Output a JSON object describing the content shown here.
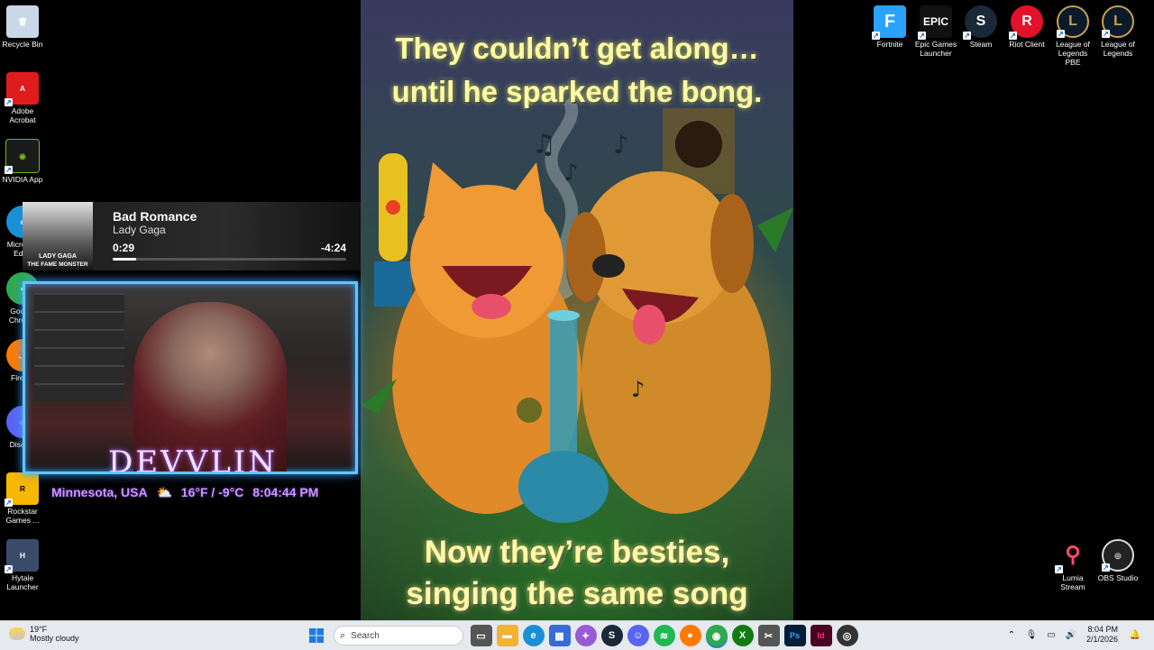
{
  "desktop": {
    "left_icons": [
      {
        "label": "Recycle Bin",
        "icon": "recycle-bin-icon",
        "color": "#c9d7e8"
      },
      {
        "label": "Adobe Acrobat",
        "icon": "acrobat-icon",
        "color": "#e01b1b"
      },
      {
        "label": "NVIDIA App",
        "icon": "nvidia-icon",
        "color": "#1a1a1a"
      },
      {
        "label": "Microsoft Edge",
        "icon": "edge-icon",
        "color": "#1b8fd6"
      },
      {
        "label": "Google Chrome",
        "icon": "chrome-icon",
        "color": "#2fa84f"
      },
      {
        "label": "Firefox",
        "icon": "firefox-icon",
        "color": "#ff7a00"
      },
      {
        "label": "Discord",
        "icon": "discord-icon",
        "color": "#5865f2"
      },
      {
        "label": "Rockstar Games ...",
        "icon": "rockstar-icon",
        "color": "#f6b800"
      },
      {
        "label": "Hytale Launcher",
        "icon": "hytale-icon",
        "color": "#3a4a6a"
      }
    ],
    "top_right_icons": [
      {
        "label": "Fortnite",
        "icon": "fortnite-icon",
        "color": "#2aa2ff",
        "glyph": "F"
      },
      {
        "label": "Epic Games Launcher",
        "icon": "epic-games-icon",
        "color": "#111111",
        "glyph": "EPIC"
      },
      {
        "label": "Steam",
        "icon": "steam-icon",
        "color": "#1b2838",
        "glyph": "S"
      },
      {
        "label": "Riot Client",
        "icon": "riot-client-icon",
        "color": "#e4112a",
        "glyph": "R"
      },
      {
        "label": "League of Legends PBE",
        "icon": "league-pbe-icon",
        "color": "#c8a24a",
        "glyph": "L"
      },
      {
        "label": "League of Legends",
        "icon": "league-icon",
        "color": "#c8a24a",
        "glyph": "L"
      }
    ],
    "bottom_right_icons": [
      {
        "label": "Lumia Stream",
        "icon": "lumia-stream-icon",
        "color": "#ff4a6a"
      },
      {
        "label": "OBS Studio",
        "icon": "obs-studio-icon",
        "color": "#222222"
      }
    ]
  },
  "meme": {
    "top_line1": "They couldn’t get along…",
    "top_line2": "until he sparked the bong.",
    "bottom_line1": "Now they’re besties,",
    "bottom_line2": "singing the same song"
  },
  "now_playing": {
    "title": "Bad Romance",
    "artist": "Lady Gaga",
    "elapsed": "0:29",
    "remaining": "-4:24",
    "progress": 0.1,
    "album_artist": "LADY GAGA",
    "album_title": "THE FAME MONSTER"
  },
  "webcam": {
    "name": "DEVVLIN",
    "location": "Minnesota, USA",
    "temperature": "16°F / -9°C",
    "time": "8:04:44 PM"
  },
  "taskbar": {
    "weather_temp": "19°F",
    "weather_condition": "Mostly cloudy",
    "search_placeholder": "Search",
    "apps": [
      {
        "name": "task-view-icon",
        "color": "#555555"
      },
      {
        "name": "file-explorer-icon",
        "color": "#f2b233"
      },
      {
        "name": "edge-icon",
        "color": "#1b8fd6"
      },
      {
        "name": "microsoft-store-icon",
        "color": "#3a6ad6"
      },
      {
        "name": "copilot-icon",
        "color": "#9a5ad6"
      },
      {
        "name": "steam-icon",
        "color": "#1b2838"
      },
      {
        "name": "discord-icon",
        "color": "#5865f2"
      },
      {
        "name": "spotify-icon",
        "color": "#1db954"
      },
      {
        "name": "firefox-icon",
        "color": "#ff7a00"
      },
      {
        "name": "chrome-icon",
        "color": "#2fa84f"
      },
      {
        "name": "xbox-icon",
        "color": "#107c10"
      },
      {
        "name": "snipping-tool-icon",
        "color": "#555555"
      },
      {
        "name": "photoshop-icon",
        "color": "#001e36"
      },
      {
        "name": "indesign-icon",
        "color": "#49021f"
      },
      {
        "name": "obs-icon",
        "color": "#333333"
      }
    ],
    "clock_time": "8:04 PM",
    "clock_date": "2/1/2026"
  }
}
